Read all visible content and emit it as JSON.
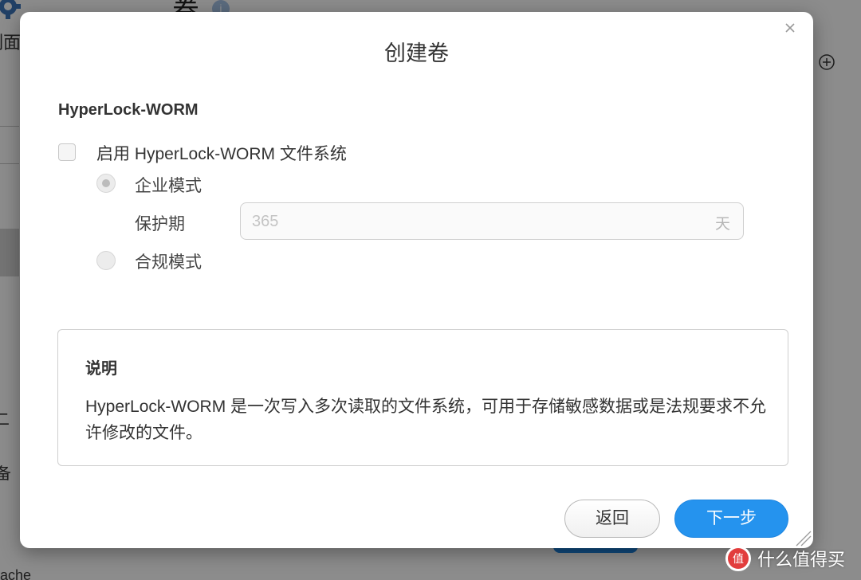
{
  "background": {
    "title": "卷",
    "info_glyph": "i",
    "left_text": "制面",
    "fragment1": "二",
    "fragment2": "备",
    "fragment3": "ache"
  },
  "dialog": {
    "title": "创建卷",
    "section_title": "HyperLock-WORM",
    "enable_checkbox": {
      "label": "启用 HyperLock-WORM 文件系统",
      "checked": false
    },
    "modes": [
      {
        "label": "企业模式",
        "selected": true
      },
      {
        "label": "合规模式",
        "selected": false
      }
    ],
    "protection_period": {
      "label": "保护期",
      "value": "365",
      "unit": "天"
    },
    "info": {
      "title": "说明",
      "text": "HyperLock-WORM 是一次写入多次读取的文件系统，可用于存储敏感数据或是法规要求不允许修改的文件。"
    },
    "buttons": {
      "back": "返回",
      "next": "下一步"
    }
  },
  "watermark": {
    "badge": "值",
    "text": "什么值得买"
  },
  "colors": {
    "primary": "#2593ee",
    "border": "#cfcfcf",
    "text": "#333333"
  }
}
